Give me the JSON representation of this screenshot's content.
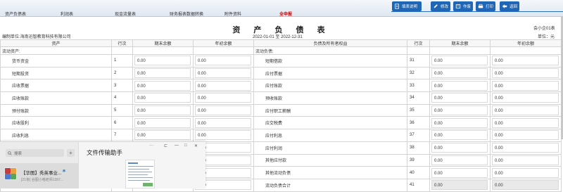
{
  "tabs": [
    {
      "label": "资产负债表"
    },
    {
      "label": "利润表"
    },
    {
      "label": "现金流量表"
    },
    {
      "label": "财务报表数据转换"
    },
    {
      "label": "附件资料"
    },
    {
      "label": "全申报"
    }
  ],
  "toolbar": {
    "fill_guide": "填表说明",
    "edit": "修改",
    "void": "作废",
    "print": "打印",
    "back": "返回"
  },
  "report": {
    "title": "资  产  负  债  表",
    "form_code": "会小企01表",
    "company": "编制单位:海南迅智教育科技有限公司",
    "period": "2022-01-01 至 2022-12-31",
    "unit": "单位：元"
  },
  "columns": {
    "asset": "资产",
    "line_no": "行次",
    "end_balance": "期末余额",
    "begin_balance": "年初余额",
    "liability": "负债及所有者权益",
    "line_no_2": "行次",
    "end_balance_2": "期末余额",
    "begin_balance_2": "年初余额"
  },
  "section": {
    "current_assets": "流动资产:",
    "current_liabilities": "流动负债:"
  },
  "rows": [
    {
      "a_item": "货币资金",
      "a_no": "1",
      "a_end": "0.00",
      "a_begin": "0.00",
      "l_item": "短期借款",
      "l_no": "31",
      "l_end": "0.00",
      "l_begin": "0.00"
    },
    {
      "a_item": "短期投资",
      "a_no": "2",
      "a_end": "0.00",
      "a_begin": "0.00",
      "l_item": "应付票据",
      "l_no": "32",
      "l_end": "0.00",
      "l_begin": "0.00"
    },
    {
      "a_item": "应收票据",
      "a_no": "3",
      "a_end": "0.00",
      "a_begin": "0.00",
      "l_item": "应付账款",
      "l_no": "33",
      "l_end": "0.00",
      "l_begin": "0.00"
    },
    {
      "a_item": "应收账款",
      "a_no": "4",
      "a_end": "0.00",
      "a_begin": "0.00",
      "l_item": "预收账款",
      "l_no": "34",
      "l_end": "0.00",
      "l_begin": "0.00"
    },
    {
      "a_item": "预付账款",
      "a_no": "5",
      "a_end": "0.00",
      "a_begin": "0.00",
      "l_item": "应付职工薪酬",
      "l_no": "35",
      "l_end": "0.00",
      "l_begin": "0.00"
    },
    {
      "a_item": "应收股利",
      "a_no": "6",
      "a_end": "0.00",
      "a_begin": "0.00",
      "l_item": "应交税费",
      "l_no": "36",
      "l_end": "0.00",
      "l_begin": "0.00"
    },
    {
      "a_item": "应收利息",
      "a_no": "7",
      "a_end": "0.00",
      "a_begin": "0.00",
      "l_item": "应付利息",
      "l_no": "37",
      "l_end": "0.00",
      "l_begin": "0.00"
    },
    {
      "a_item": "",
      "a_no": "",
      "a_end": "",
      "a_begin": "0.00",
      "l_item": "应付利润",
      "l_no": "38",
      "l_end": "0.00",
      "l_begin": "0.00"
    },
    {
      "a_item": "",
      "a_no": "",
      "a_end": "",
      "a_begin": "0.00",
      "l_item": "其他应付款",
      "l_no": "39",
      "l_end": "0.00",
      "l_begin": "0.00"
    },
    {
      "a_item": "",
      "a_no": "",
      "a_end": "",
      "a_begin": "0.00",
      "l_item": "其他流动负债",
      "l_no": "40",
      "l_end": "0.00",
      "l_begin": "0.00"
    },
    {
      "a_item": "",
      "a_no": "",
      "a_end": "",
      "a_begin": "0.00",
      "l_item": "流动负债合计",
      "l_no": "41",
      "l_end": "0.00",
      "l_begin": "0.00"
    }
  ],
  "wechat": {
    "search_placeholder": "搜索",
    "plus": "+",
    "chat_title": "【华图】秀英事业...",
    "chat_sub": "[21条] 谷图小喵老师1397...",
    "window_title": "文件传输助手",
    "ctrl_more": "···",
    "ctrl_pin": "⊏",
    "ctrl_min": "—",
    "ctrl_max": "□",
    "ctrl_close": "✕"
  },
  "colors": {
    "tab_active": "#d40000",
    "toolbar_blue": "#1f66b7"
  }
}
